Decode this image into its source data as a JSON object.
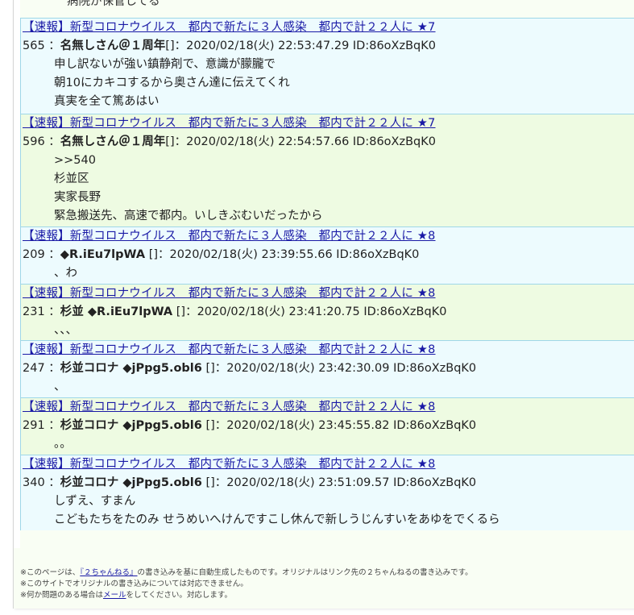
{
  "top_fragment": "病院が保管してる",
  "thread_title": "【速報】新型コロナウイルス　都内で新たに３人感染　都内で計２２人に",
  "posts": [
    {
      "star": "★7",
      "num": "565",
      "name": "名無しさん＠１周年",
      "trip": "",
      "meta": "[]：2020/02/18(火) 22:53:47.29 ID:86oXzBqK0",
      "lines": [
        "申し訳ないが強い鎮静剤で、意識が朦朧で",
        "朝10にカキコするから奥さん達に伝えてくれ",
        "真実を全て篤あはい"
      ]
    },
    {
      "star": "★7",
      "num": "596",
      "name": "名無しさん＠１周年",
      "trip": "",
      "meta": "[]：2020/02/18(火) 22:54:57.66 ID:86oXzBqK0",
      "lines": [
        ">>540",
        "杉並区",
        "実家長野",
        "緊急搬送先、高速で都内。いしきぶむいだったから"
      ]
    },
    {
      "star": "★8",
      "num": "209",
      "name": "",
      "trip": "◆R.iEu7lpWA",
      "meta": " []：2020/02/18(火) 23:39:55.66 ID:86oXzBqK0",
      "lines": [
        "、わ"
      ]
    },
    {
      "star": "★8",
      "num": "231",
      "name": "杉並",
      "trip": " ◆R.iEu7lpWA",
      "meta": " []：2020/02/18(火) 23:41:20.75 ID:86oXzBqK0",
      "lines": [
        "、、、"
      ]
    },
    {
      "star": "★8",
      "num": "247",
      "name": "杉並コロナ",
      "trip": " ◆jPpg5.obl6",
      "meta": " []：2020/02/18(火) 23:42:30.09 ID:86oXzBqK0",
      "lines": [
        "、"
      ]
    },
    {
      "star": "★8",
      "num": "291",
      "name": "杉並コロナ",
      "trip": " ◆jPpg5.obl6",
      "meta": " []：2020/02/18(火) 23:45:55.82 ID:86oXzBqK0",
      "lines": [
        "。。"
      ]
    },
    {
      "star": "★8",
      "num": "340",
      "name": "杉並コロナ",
      "trip": " ◆jPpg5.obl6",
      "meta": " []：2020/02/18(火) 23:51:09.57 ID:86oXzBqK0",
      "lines": [
        "しずえ、すまん",
        "こどもたちをたのみ せうめいへけんですこし休んで新しうじんすいをあゆをでくるら"
      ]
    }
  ],
  "footer": {
    "line1_pre": "※このページは、",
    "line1_link": "『２ちゃんねる』",
    "line1_post": "の書き込みを基に自動生成したものです。オリジナルはリンク先の２ちゃんねるの書き込みです。",
    "line2": "※このサイトでオリジナルの書き込みについては対応できません。",
    "line3_pre": "※何か問題のある場合は",
    "line3_link": "メール",
    "line3_post": "をしてください。対応します。"
  }
}
